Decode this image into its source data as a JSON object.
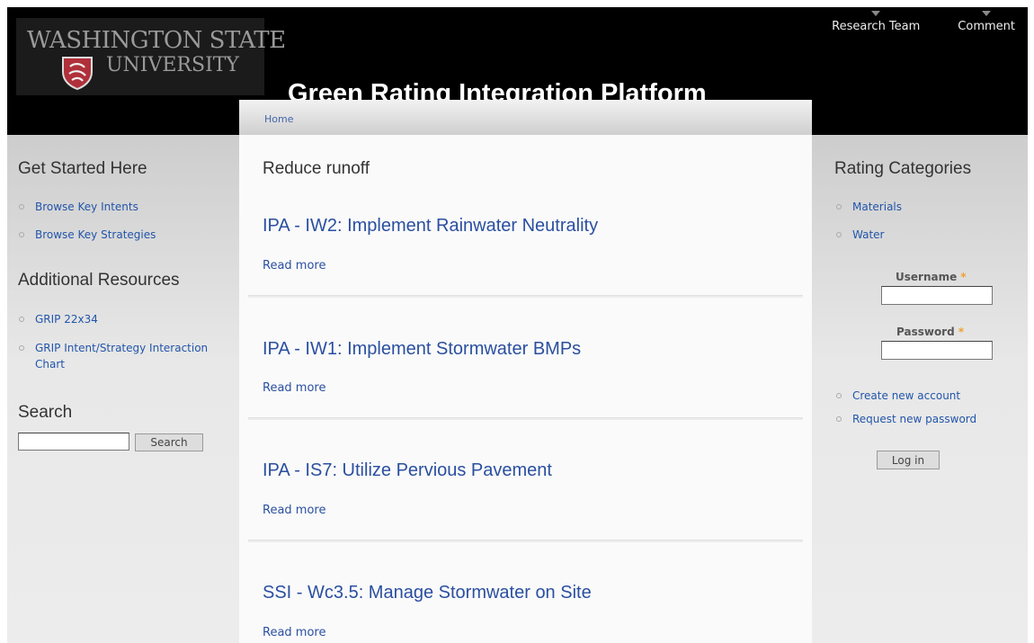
{
  "header": {
    "logo_line1": "WASHINGTON STATE",
    "logo_line2": "UNIVERSITY",
    "site_name": "Green Rating Integration Platform",
    "top_links": [
      "Research Team",
      "Comment"
    ]
  },
  "breadcrumb": {
    "home": "Home"
  },
  "sidebar_left": {
    "get_started_title": "Get Started Here",
    "get_started_items": [
      "Browse Key Intents",
      "Browse Key Strategies"
    ],
    "resources_title": "Additional Resources",
    "resources_items": [
      "GRIP 22x34",
      "GRIP Intent/Strategy Interaction Chart"
    ],
    "search_title": "Search",
    "search_value": "",
    "search_button": "Search"
  },
  "main": {
    "title": "Reduce runoff",
    "nodes": [
      {
        "title": "IPA - IW2: Implement Rainwater Neutrality",
        "read_more": "Read more"
      },
      {
        "title": "IPA - IW1: Implement Stormwater BMPs",
        "read_more": "Read more"
      },
      {
        "title": "IPA - IS7: Utilize Pervious Pavement",
        "read_more": "Read more"
      },
      {
        "title": "SSI - Wc3.5: Manage Stormwater on Site",
        "read_more": "Read more"
      }
    ]
  },
  "sidebar_right": {
    "categories_title": "Rating Categories",
    "categories": [
      "Materials",
      "Water"
    ],
    "username_label": "Username",
    "username_value": "",
    "password_label": "Password",
    "password_value": "",
    "required_mark": "*",
    "links": [
      "Create new account",
      "Request new password"
    ],
    "login_button": "Log in"
  },
  "colors": {
    "link": "#2a4fa0",
    "header_bg": "#000000",
    "required": "#f0a030"
  }
}
